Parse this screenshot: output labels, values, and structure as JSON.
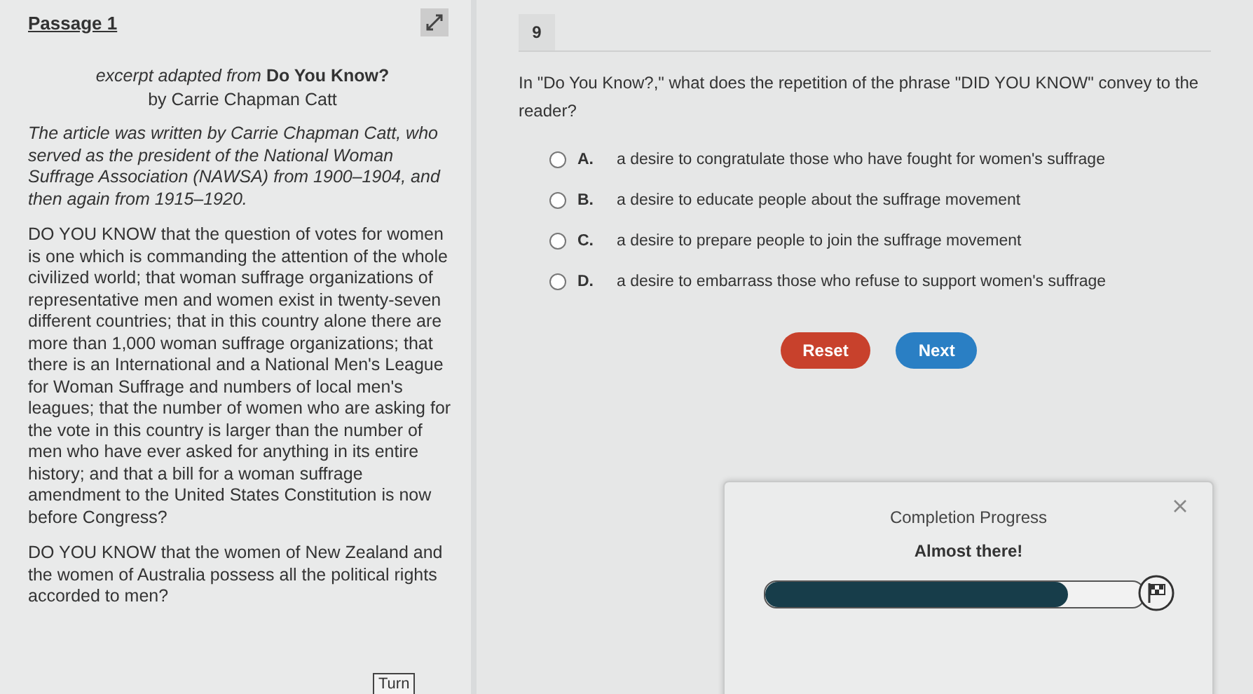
{
  "passage": {
    "title": "Passage 1",
    "source": "*excerpt adapted from* **Do You Know?**",
    "author": "by Carrie Chapman Catt",
    "intro": "The article was written by Carrie Chapman Catt, who served as the president of the National Woman Suffrage Association (NAWSA) from 1900–1904, and then again from 1915–1920.",
    "paragraphs": [
      "DO YOU KNOW that the question of votes for women is one which is commanding the attention of the whole civilized world; that woman suffrage organizations of representative men and women exist in twenty-seven different countries; that in this country alone there are more than 1,000 woman suffrage organizations; that there is an International and a National Men's League for Woman Suffrage and numbers of local men's leagues; that the number of women who are asking for the vote in this country is larger than the number of men who have ever asked for anything in its entire history; and that a bill for a woman suffrage amendment to the United States Constitution is now before Congress?",
      "DO YOU KNOW that the women of New Zealand and the women of Australia possess all the political rights accorded to men?"
    ]
  },
  "question": {
    "number": "9",
    "prompt": "In \"Do You Know?,\" what does the repetition of the phrase \"DID YOU KNOW\" convey to the reader?",
    "choices": [
      {
        "letter": "A.",
        "text": "a desire to congratulate those who have fought for women's suffrage",
        "selected": false
      },
      {
        "letter": "B.",
        "text": "a desire to educate people about the suffrage movement",
        "selected": false
      },
      {
        "letter": "C.",
        "text": "a desire to prepare people to join the suffrage movement",
        "selected": false
      },
      {
        "letter": "D.",
        "text": "a desire to embarrass those who refuse to support women's suffrage",
        "selected": false
      }
    ],
    "buttons": [
      {
        "label": "Reset",
        "kind": "reset"
      },
      {
        "label": "Next",
        "kind": "next"
      }
    ]
  },
  "progress": {
    "title": "Completion Progress",
    "message": "Almost there!",
    "level": 0.8
  },
  "turn_button": "Turn"
}
